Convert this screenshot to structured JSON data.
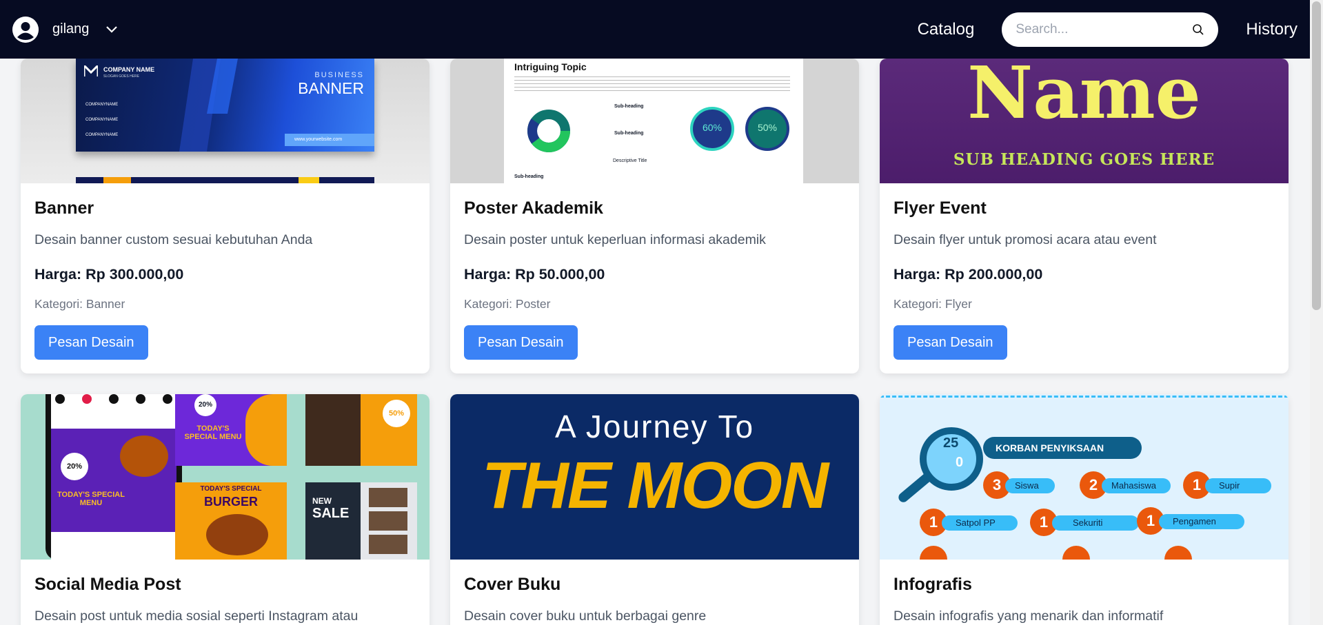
{
  "nav": {
    "username": "gilang",
    "catalog_label": "Catalog",
    "search_placeholder": "Search...",
    "history_label": "History"
  },
  "cards": [
    {
      "title": "Banner",
      "description": "Desain banner custom sesuai kebutuhan Anda",
      "price": "Harga: Rp 300.000,00",
      "category": "Kategori: Banner",
      "button": "Pesan Desain",
      "image": {
        "company_name": "COMPANY NAME",
        "company_sub": "SLOGAN GOES HERE",
        "kicker": "BUSINESS",
        "heading": "BANNER",
        "social_1": "COMPANYNAME",
        "social_2": "COMPANYNAME",
        "social_3": "COMPANYNAME",
        "website": "www.yourwebsite.com"
      }
    },
    {
      "title": "Poster Akademik",
      "description": "Desain poster untuk keperluan informasi akademik",
      "price": "Harga: Rp 50.000,00",
      "category": "Kategori: Poster",
      "button": "Pesan Desain",
      "image": {
        "heading": "Intriguing Topic",
        "sub_1": "Sub-heading",
        "sub_2": "Sub-heading",
        "sub_3": "Sub-heading",
        "stat_1": "60%",
        "stat_2": "50%",
        "chart_caption": "Descriptive Title"
      }
    },
    {
      "title": "Flyer Event",
      "description": "Desain flyer untuk promosi acara atau event",
      "price": "Harga: Rp 200.000,00",
      "category": "Kategori: Flyer",
      "button": "Pesan Desain",
      "image": {
        "heading": "Name",
        "subheading": "SUB HEADING GOES HERE"
      }
    },
    {
      "title": "Social Media Post",
      "description": "Desain post untuk media sosial seperti Instagram atau",
      "image": {
        "badge_1": "20%",
        "badge_2": "20%",
        "badge_3": "50%",
        "headline_1": "TODAY'S SPECIAL MENU",
        "headline_2": "TODAY'S SPECIAL MENU",
        "headline_3": "TODAY'S SPECIAL",
        "headline_4": "BURGER",
        "headline_5": "NEW",
        "headline_6": "SALE"
      }
    },
    {
      "title": "Cover Buku",
      "description": "Desain cover buku untuk berbagai genre",
      "image": {
        "line_1": "A Journey To",
        "line_2": "THE MOON"
      }
    },
    {
      "title": "Infografis",
      "description": "Desain infografis yang menarik dan informatif",
      "image": {
        "stat_top": "25",
        "stat_mid": "0",
        "header": "KORBAN PENYIKSAAN",
        "items": [
          {
            "num": "3",
            "label": "Siswa"
          },
          {
            "num": "2",
            "label": "Mahasiswa"
          },
          {
            "num": "1",
            "label": "Supir"
          },
          {
            "num": "1",
            "label": "Satpol PP"
          },
          {
            "num": "1",
            "label": "Sekuriti"
          },
          {
            "num": "1",
            "label": "Pengamen"
          }
        ]
      }
    }
  ],
  "colors": {
    "navbar_bg": "#060b22",
    "primary_button": "#3b82f6",
    "page_bg": "#f3f4f6"
  }
}
